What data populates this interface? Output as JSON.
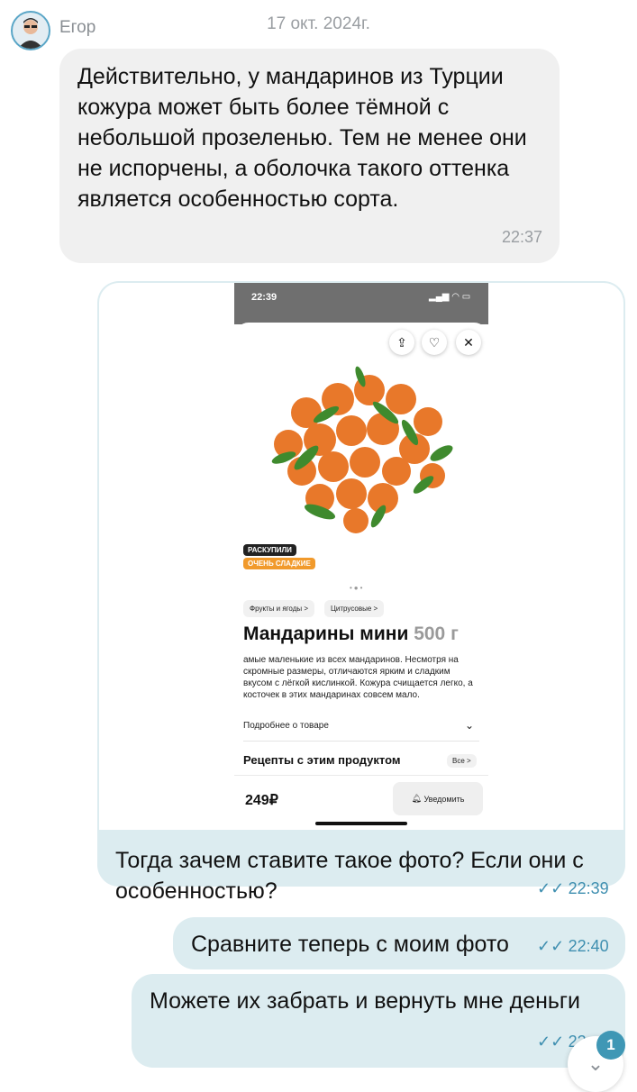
{
  "chat": {
    "date": "17 окт. 2024г.",
    "sender": "Егор",
    "incoming": {
      "text": "Действительно, у мандаринов из Турции кожура может быть более тёмной с небольшой прозеленью. Тем не менее они не испорчены, а оболочка такого оттенка является особенностью сорта.",
      "time": "22:37"
    },
    "outgoing": [
      {
        "text": "Тогда зачем ставите такое фото? Если они с особенностью?",
        "time": "22:39",
        "status": "✓✓"
      },
      {
        "text": "Сравните теперь с моим фото",
        "time": "22:40",
        "status": "✓✓"
      },
      {
        "text": "Можете их забрать и вернуть мне деньги",
        "time": "22:",
        "status": "✓✓"
      }
    ],
    "unread_count": "1"
  },
  "screenshot": {
    "status_time": "22:39",
    "badges": [
      "РАСКУПИЛИ",
      "ОЧЕНЬ СЛАДКИЕ"
    ],
    "categories": [
      "Фрукты и ягоды >",
      "Цитрусовые >"
    ],
    "product_name": "Мандарины мини",
    "product_weight": "500 г",
    "description": "амые маленькие из всех мандаринов. Несмотря на скромные размеры, отличаются ярким и сладким вкусом с лёгкой кислинкой. Кожура счищается легко, а косточек в этих мандаринах совсем мало.",
    "more_label": "Подробнее о товаре",
    "recipes_label": "Рецепты с этим продуктом",
    "all_label": "Все >",
    "price": "249₽",
    "notify_label": "Уведомить"
  },
  "colors": {
    "incoming_bubble": "#f0f0f0",
    "outgoing_bubble": "#dcecf0",
    "accent": "#3f97b5",
    "badge_orange": "#f19a2c"
  },
  "icons": [
    "avatar",
    "share-icon",
    "heart-icon",
    "close-icon",
    "chevron-down-icon",
    "bell-icon",
    "double-check-icon",
    "scroll-down-icon"
  ]
}
